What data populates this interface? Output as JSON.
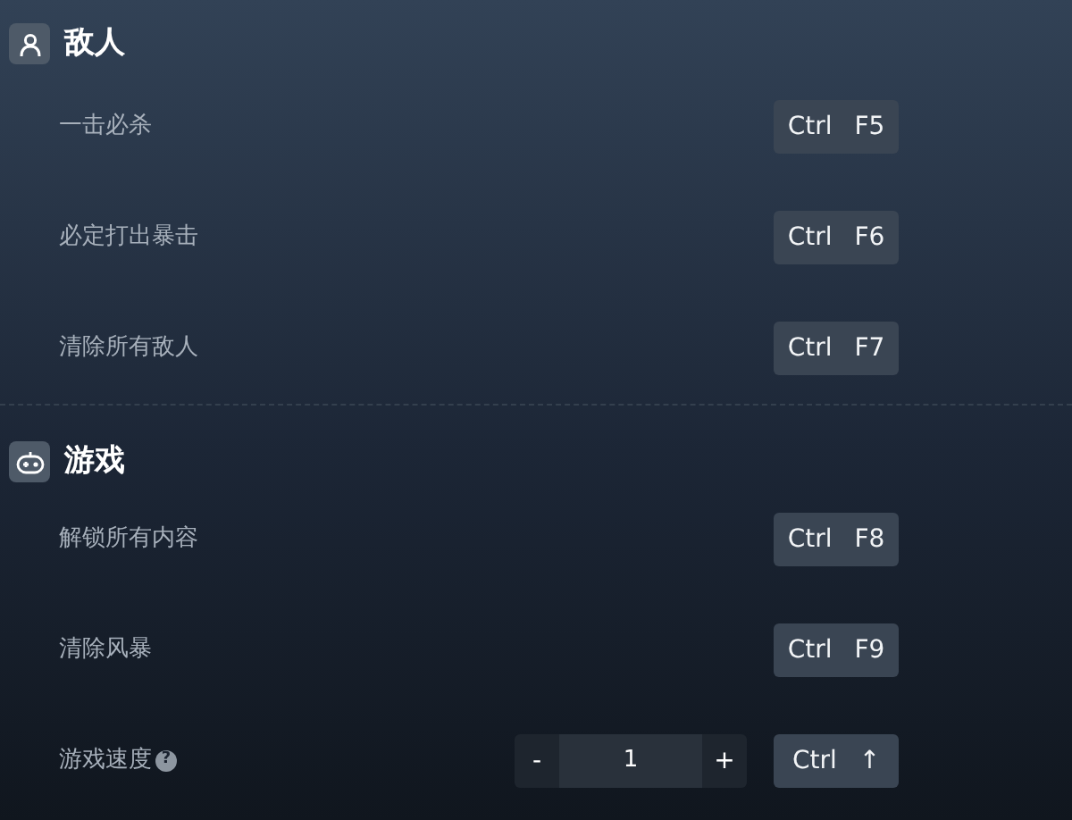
{
  "sections": [
    {
      "title": "敌人",
      "items": [
        {
          "kind": "toggle",
          "label": "一击必杀",
          "keys": [
            "Ctrl",
            "F5"
          ]
        },
        {
          "kind": "toggle",
          "label": "必定打出暴击",
          "keys": [
            "Ctrl",
            "F6"
          ]
        },
        {
          "kind": "toggle",
          "label": "清除所有敌人",
          "keys": [
            "Ctrl",
            "F7"
          ]
        }
      ]
    },
    {
      "title": "游戏",
      "items": [
        {
          "kind": "toggle",
          "label": "解锁所有内容",
          "keys": [
            "Ctrl",
            "F8"
          ]
        },
        {
          "kind": "toggle",
          "label": "清除风暴",
          "keys": [
            "Ctrl",
            "F9"
          ]
        },
        {
          "kind": "stepper",
          "label": "游戏速度",
          "help": "?",
          "minus": "-",
          "value": "1",
          "plus": "+",
          "keys": [
            "Ctrl",
            "↑"
          ]
        }
      ]
    }
  ]
}
